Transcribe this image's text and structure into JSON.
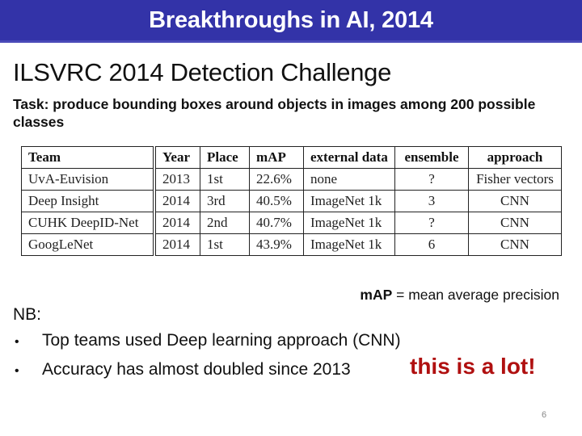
{
  "slide": {
    "title": "Breakthroughs in AI, 2014",
    "subtitle": "ILSVRC 2014 Detection Challenge",
    "task": "Task: produce bounding boxes around objects in images among 200 possible classes",
    "table": {
      "headers": [
        "Team",
        "Year",
        "Place",
        "mAP",
        "external data",
        "ensemble",
        "approach"
      ],
      "rows": [
        [
          "UvA-Euvision",
          "2013",
          "1st",
          "22.6%",
          "none",
          "?",
          "Fisher vectors"
        ],
        [
          "Deep Insight",
          "2014",
          "3rd",
          "40.5%",
          "ImageNet 1k",
          "3",
          "CNN"
        ],
        [
          "CUHK DeepID-Net",
          "2014",
          "2nd",
          "40.7%",
          "ImageNet 1k",
          "?",
          "CNN"
        ],
        [
          "GoogLeNet",
          "2014",
          "1st",
          "43.9%",
          "ImageNet 1k",
          "6",
          "CNN"
        ]
      ]
    },
    "map_definition": {
      "term": "mAP",
      "definition": " = mean average precision"
    },
    "nb_label": "NB:",
    "bullets": [
      "Top teams used Deep learning approach (CNN)",
      "Accuracy has almost doubled since 2013"
    ],
    "bullet_glyph": "•",
    "emphasis": "this is a lot!",
    "page_number": "6"
  },
  "colors": {
    "title_bar": "#3333a8",
    "emphasis": "#b01010"
  }
}
